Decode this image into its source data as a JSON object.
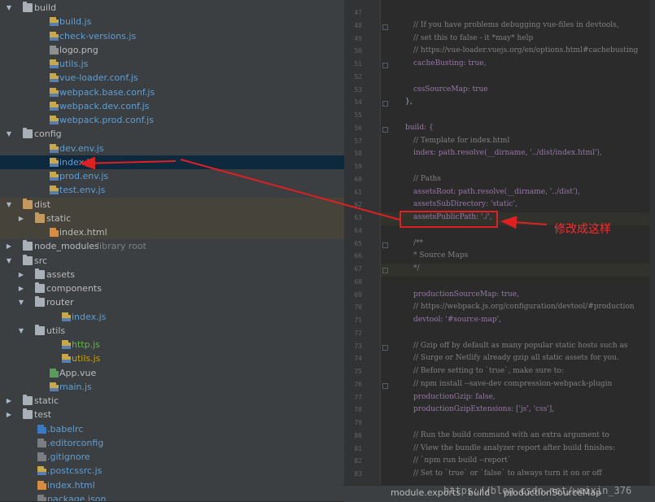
{
  "tree": [
    {
      "depth": 0,
      "type": "folder",
      "expanded": true,
      "name": "build"
    },
    {
      "depth": 1,
      "type": "file",
      "kind": "js",
      "name": "build.js",
      "color": "blue"
    },
    {
      "depth": 1,
      "type": "file",
      "kind": "js",
      "name": "check-versions.js",
      "color": "blue"
    },
    {
      "depth": 1,
      "type": "file",
      "kind": "img",
      "name": "logo.png",
      "color": "plain"
    },
    {
      "depth": 1,
      "type": "file",
      "kind": "js",
      "name": "utils.js",
      "color": "blue"
    },
    {
      "depth": 1,
      "type": "file",
      "kind": "js",
      "name": "vue-loader.conf.js",
      "color": "blue"
    },
    {
      "depth": 1,
      "type": "file",
      "kind": "js",
      "name": "webpack.base.conf.js",
      "color": "blue"
    },
    {
      "depth": 1,
      "type": "file",
      "kind": "js",
      "name": "webpack.dev.conf.js",
      "color": "blue"
    },
    {
      "depth": 1,
      "type": "file",
      "kind": "js",
      "name": "webpack.prod.conf.js",
      "color": "blue"
    },
    {
      "depth": 0,
      "type": "folder",
      "expanded": true,
      "name": "config"
    },
    {
      "depth": 1,
      "type": "file",
      "kind": "js",
      "name": "dev.env.js",
      "color": "blue"
    },
    {
      "depth": 1,
      "type": "file",
      "kind": "js",
      "name": "index.js",
      "color": "blue",
      "selected": true
    },
    {
      "depth": 1,
      "type": "file",
      "kind": "js",
      "name": "prod.env.js",
      "color": "blue"
    },
    {
      "depth": 1,
      "type": "file",
      "kind": "js",
      "name": "test.env.js",
      "color": "blue"
    },
    {
      "depth": 0,
      "type": "folder",
      "expanded": true,
      "name": "dist",
      "excluded": true
    },
    {
      "depth": 1,
      "type": "folder",
      "expanded": false,
      "name": "static",
      "excluded": true
    },
    {
      "depth": 1,
      "type": "file",
      "kind": "html",
      "name": "index.html",
      "color": "plain",
      "excluded": true
    },
    {
      "depth": 0,
      "type": "folder",
      "expanded": false,
      "name": "node_modules",
      "suffix": "library root"
    },
    {
      "depth": 0,
      "type": "folder",
      "expanded": true,
      "name": "src"
    },
    {
      "depth": 1,
      "type": "folder",
      "expanded": false,
      "name": "assets"
    },
    {
      "depth": 1,
      "type": "folder",
      "expanded": false,
      "name": "components"
    },
    {
      "depth": 1,
      "type": "folder",
      "expanded": true,
      "name": "router"
    },
    {
      "depth": 2,
      "type": "file",
      "kind": "js",
      "name": "index.js",
      "color": "blue"
    },
    {
      "depth": 1,
      "type": "folder",
      "expanded": true,
      "name": "utils"
    },
    {
      "depth": 2,
      "type": "file",
      "kind": "js",
      "name": "http.js",
      "color": "green"
    },
    {
      "depth": 2,
      "type": "file",
      "kind": "js",
      "name": "utils.js",
      "color": "yellow"
    },
    {
      "depth": 1,
      "type": "file",
      "kind": "vue",
      "name": "App.vue",
      "color": "plain"
    },
    {
      "depth": 1,
      "type": "file",
      "kind": "js",
      "name": "main.js",
      "color": "blue"
    },
    {
      "depth": 0,
      "type": "folder",
      "expanded": false,
      "name": "static"
    },
    {
      "depth": 0,
      "type": "folder",
      "expanded": false,
      "name": "test"
    },
    {
      "depth": 0,
      "type": "file",
      "kind": "bab",
      "name": ".babelrc",
      "color": "blue"
    },
    {
      "depth": 0,
      "type": "file",
      "kind": "cfg",
      "name": ".editorconfig",
      "color": "blue"
    },
    {
      "depth": 0,
      "type": "file",
      "kind": "cfg",
      "name": ".gitignore",
      "color": "blue"
    },
    {
      "depth": 0,
      "type": "file",
      "kind": "js",
      "name": ".postcssrc.js",
      "color": "blue"
    },
    {
      "depth": 0,
      "type": "file",
      "kind": "html",
      "name": "index.html",
      "color": "blue"
    },
    {
      "depth": 0,
      "type": "file",
      "kind": "cfg",
      "name": "package.json",
      "color": "blue"
    }
  ],
  "code": [
    {
      "ln": "47",
      "text": "",
      "cls": "cm"
    },
    {
      "ln": "48",
      "text": "// If you have problems debugging vue-files in devtools,",
      "cls": "cm",
      "indent": 1
    },
    {
      "ln": "49",
      "text": "// set this to false - it *may* help",
      "cls": "cm",
      "indent": 1
    },
    {
      "ln": "50",
      "text": "// https://vue-loader.vuejs.org/en/options.html#cachebusting",
      "cls": "cm",
      "indent": 1
    },
    {
      "ln": "51",
      "text": "cacheBusting: true,",
      "cls": "prop",
      "indent": 1
    },
    {
      "ln": "52",
      "text": "",
      "cls": "cm"
    },
    {
      "ln": "53",
      "text": "cssSourceMap: true",
      "cls": "prop",
      "indent": 1
    },
    {
      "ln": "54",
      "text": "},",
      "cls": "code"
    },
    {
      "ln": "55",
      "text": "",
      "cls": "cm"
    },
    {
      "ln": "56",
      "text": "build: {",
      "cls": "prop"
    },
    {
      "ln": "57",
      "text": "// Template for index.html",
      "cls": "cm",
      "indent": 1
    },
    {
      "ln": "58",
      "text": "index: path.resolve(__dirname, '../dist/index.html'),",
      "cls": "prop",
      "indent": 1
    },
    {
      "ln": "59",
      "text": "",
      "cls": "cm"
    },
    {
      "ln": "60",
      "text": "// Paths",
      "cls": "cm",
      "indent": 1
    },
    {
      "ln": "61",
      "text": "assetsRoot: path.resolve(__dirname, '../dist'),",
      "cls": "prop",
      "indent": 1
    },
    {
      "ln": "62",
      "text": "assetsSubDirectory: 'static',",
      "cls": "prop",
      "indent": 1
    },
    {
      "ln": "63",
      "text": "assetsPublicPath: './',",
      "cls": "prop",
      "indent": 1
    },
    {
      "ln": "64",
      "text": "",
      "cls": "cm"
    },
    {
      "ln": "65",
      "text": "/**",
      "cls": "cm",
      "indent": 1
    },
    {
      "ln": "66",
      "text": " * Source Maps",
      "cls": "cm",
      "indent": 1
    },
    {
      "ln": "67",
      "text": " */",
      "cls": "cm",
      "indent": 1
    },
    {
      "ln": "68",
      "text": "",
      "cls": "cm"
    },
    {
      "ln": "69",
      "text": "productionSourceMap: true,",
      "cls": "prop",
      "indent": 1
    },
    {
      "ln": "70",
      "text": "// https://webpack.js.org/configuration/devtool/#production",
      "cls": "cm",
      "indent": 1
    },
    {
      "ln": "71",
      "text": "devtool: '#source-map',",
      "cls": "prop",
      "indent": 1
    },
    {
      "ln": "72",
      "text": "",
      "cls": "cm"
    },
    {
      "ln": "73",
      "text": "// Gzip off by default as many popular static hosts such as",
      "cls": "cm",
      "indent": 1
    },
    {
      "ln": "74",
      "text": "// Surge or Netlify already gzip all static assets for you.",
      "cls": "cm",
      "indent": 1
    },
    {
      "ln": "75",
      "text": "// Before setting to `true`, make sure to:",
      "cls": "cm",
      "indent": 1
    },
    {
      "ln": "76",
      "text": "// npm install --save-dev compression-webpack-plugin",
      "cls": "cm",
      "indent": 1
    },
    {
      "ln": "77",
      "text": "productionGzip: false,",
      "cls": "prop",
      "indent": 1
    },
    {
      "ln": "78",
      "text": "productionGzipExtensions: ['js', 'css'],",
      "cls": "prop",
      "indent": 1
    },
    {
      "ln": "79",
      "text": "",
      "cls": "cm"
    },
    {
      "ln": "80",
      "text": "// Run the build command with an extra argument to",
      "cls": "cm",
      "indent": 1
    },
    {
      "ln": "81",
      "text": "// View the bundle analyzer report after build finishes:",
      "cls": "cm",
      "indent": 1
    },
    {
      "ln": "82",
      "text": "// `npm run build --report`",
      "cls": "cm",
      "indent": 1
    },
    {
      "ln": "83",
      "text": "// Set to `true` or `false` to always turn it on or off",
      "cls": "cm",
      "indent": 1
    }
  ],
  "status": {
    "crumb1": "module.exports",
    "crumb2": "build",
    "crumb3": "productionSourceMap"
  },
  "watermark": "https://blog.csdn.net/weixin_376",
  "annotation": {
    "text": "修改成这样",
    "color": "#e02020"
  },
  "colors": {
    "selection": "#0d293e",
    "excluded": "#45433a",
    "comment": "#808080",
    "keyword": "#cc7832",
    "property": "#9876aa"
  }
}
